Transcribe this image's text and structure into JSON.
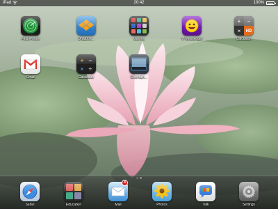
{
  "status_bar": {
    "carrier": "iPad",
    "time": "20:42",
    "battery": "100%",
    "battery_level": 1.0
  },
  "home_apps": [
    {
      "label": "Find iPhone",
      "icon": "find-iphone-icon"
    },
    {
      "label": "Dropbox...",
      "icon": "dropbox-icon"
    },
    {
      "label": "Games",
      "icon": "folder-icon"
    },
    {
      "label": "Y! Messenger",
      "icon": "yahoo-messenger-icon"
    },
    {
      "label": "Calculator",
      "icon": "calculator-hd-icon"
    },
    {
      "label": "Gmail",
      "icon": "gmail-icon"
    },
    {
      "label": "Calculator",
      "icon": "calculator-icon"
    },
    {
      "label": "Entertain...",
      "icon": "folder-icon"
    }
  ],
  "dock_apps": [
    {
      "label": "Safari",
      "icon": "safari-icon"
    },
    {
      "label": "Education",
      "icon": "folder-icon"
    },
    {
      "label": "Mail",
      "icon": "mail-icon",
      "badge": "4"
    },
    {
      "label": "Photos",
      "icon": "photos-icon"
    },
    {
      "label": "Talk",
      "icon": "google-talk-icon"
    },
    {
      "label": "Settings",
      "icon": "settings-icon"
    }
  ],
  "page_indicator": {
    "pages": 2,
    "current": 2
  },
  "colors": {
    "status_bar": "#000000",
    "badge": "#d81e1e",
    "label": "#ffffff"
  }
}
